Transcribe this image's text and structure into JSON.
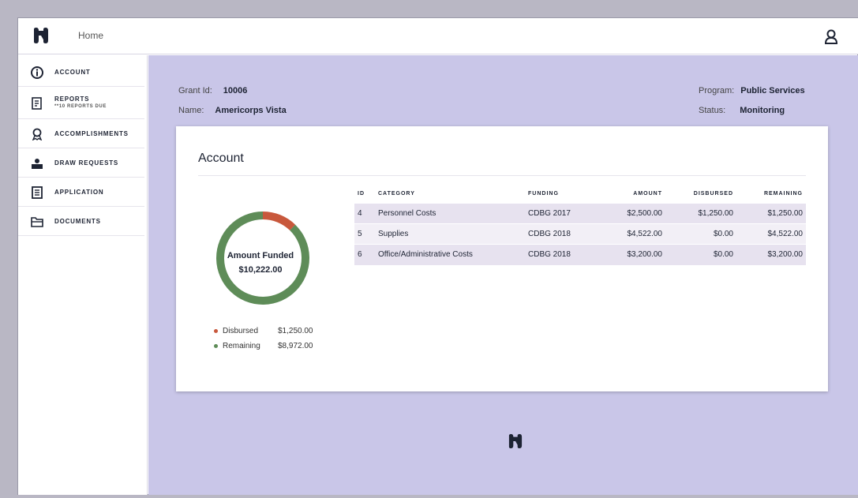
{
  "header": {
    "home_label": "Home",
    "logo_icon": "brand-logo-icon",
    "user_icon": "user-account-icon"
  },
  "sidebar": {
    "items": [
      {
        "label": "ACCOUNT",
        "icon": "info-icon"
      },
      {
        "label": "REPORTS",
        "sublabel": "**10 REPORTS DUE",
        "icon": "reports-icon"
      },
      {
        "label": "ACCOMPLISHMENTS",
        "icon": "award-icon"
      },
      {
        "label": "DRAW REQUESTS",
        "icon": "money-request-icon"
      },
      {
        "label": "APPLICATION",
        "icon": "application-icon"
      },
      {
        "label": "DOCUMENTS",
        "icon": "folder-icon"
      }
    ]
  },
  "grant": {
    "grant_id_label": "Grant Id:",
    "grant_id_value": "10006",
    "name_label": "Name:",
    "name_value": "Americorps Vista",
    "program_label": "Program:",
    "program_value": "Public Services",
    "status_label": "Status:",
    "status_value": "Monitoring"
  },
  "account_card": {
    "title": "Account",
    "donut": {
      "center_label": "Amount Funded",
      "center_value": "$10,222.00",
      "disbursed_fraction": 0.1223,
      "disbursed_color": "#c8583c",
      "remaining_color": "#5e8c58"
    },
    "legend": [
      {
        "label": "Disbursed",
        "value": "$1,250.00",
        "color": "#c8583c"
      },
      {
        "label": "Remaining",
        "value": "$8,972.00",
        "color": "#5e8c58"
      }
    ],
    "table": {
      "headers": [
        "ID",
        "CATEGORY",
        "FUNDING",
        "AMOUNT",
        "DISBURSED",
        "REMAINING"
      ],
      "rows": [
        [
          "4",
          "Personnel Costs",
          "CDBG 2017",
          "$2,500.00",
          "$1,250.00",
          "$1,250.00"
        ],
        [
          "5",
          "Supplies",
          "CDBG 2018",
          "$4,522.00",
          "$0.00",
          "$4,522.00"
        ],
        [
          "6",
          "Office/Administrative Costs",
          "CDBG 2018",
          "$3,200.00",
          "$0.00",
          "$3,200.00"
        ]
      ]
    }
  },
  "colors": {
    "accent_navy": "#1d2333",
    "main_bg": "#c9c6e8"
  }
}
